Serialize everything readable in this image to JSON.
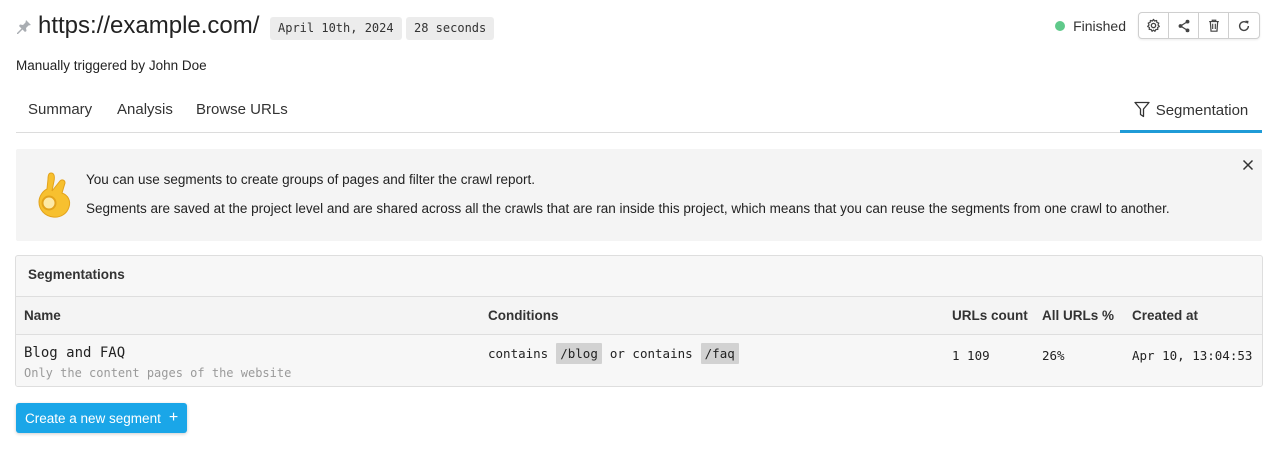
{
  "header": {
    "url": "https://example.com/",
    "date": "April 10th, 2024",
    "duration": "28 seconds",
    "status": "Finished",
    "status_color": "#5fc98a",
    "toolbar_icons": [
      "gear-icon",
      "share-icon",
      "trash-icon",
      "refresh-icon"
    ]
  },
  "trigger_text": "Manually triggered by John Doe",
  "tabs": {
    "summary": "Summary",
    "analysis": "Analysis",
    "browse": "Browse URLs",
    "segmentation": "Segmentation",
    "active_color": "#1f9bd7"
  },
  "info": {
    "line1": "You can use segments to create groups of pages and filter the crawl report.",
    "line2": "Segments are saved at the project level and are shared across all the crawls that are ran inside this project, which means that you can reuse the segments from one crawl to another."
  },
  "panel": {
    "title": "Segmentations",
    "columns": {
      "name": "Name",
      "conditions": "Conditions",
      "urls_count": "URLs count",
      "all_urls_pct": "All URLs %",
      "created_at": "Created at"
    },
    "rows": [
      {
        "name": "Blog and FAQ",
        "description": "Only the content pages of the website",
        "cond_word1": "contains",
        "cond_value1": "/blog",
        "cond_word2": "or contains",
        "cond_value2": "/faq",
        "urls_count": "1 109",
        "all_urls_pct": "26%",
        "created_at": "Apr 10, 13:04:53"
      }
    ]
  },
  "create_button": {
    "label": "Create a new segment",
    "plus": "+",
    "color": "#1aa6e8"
  }
}
